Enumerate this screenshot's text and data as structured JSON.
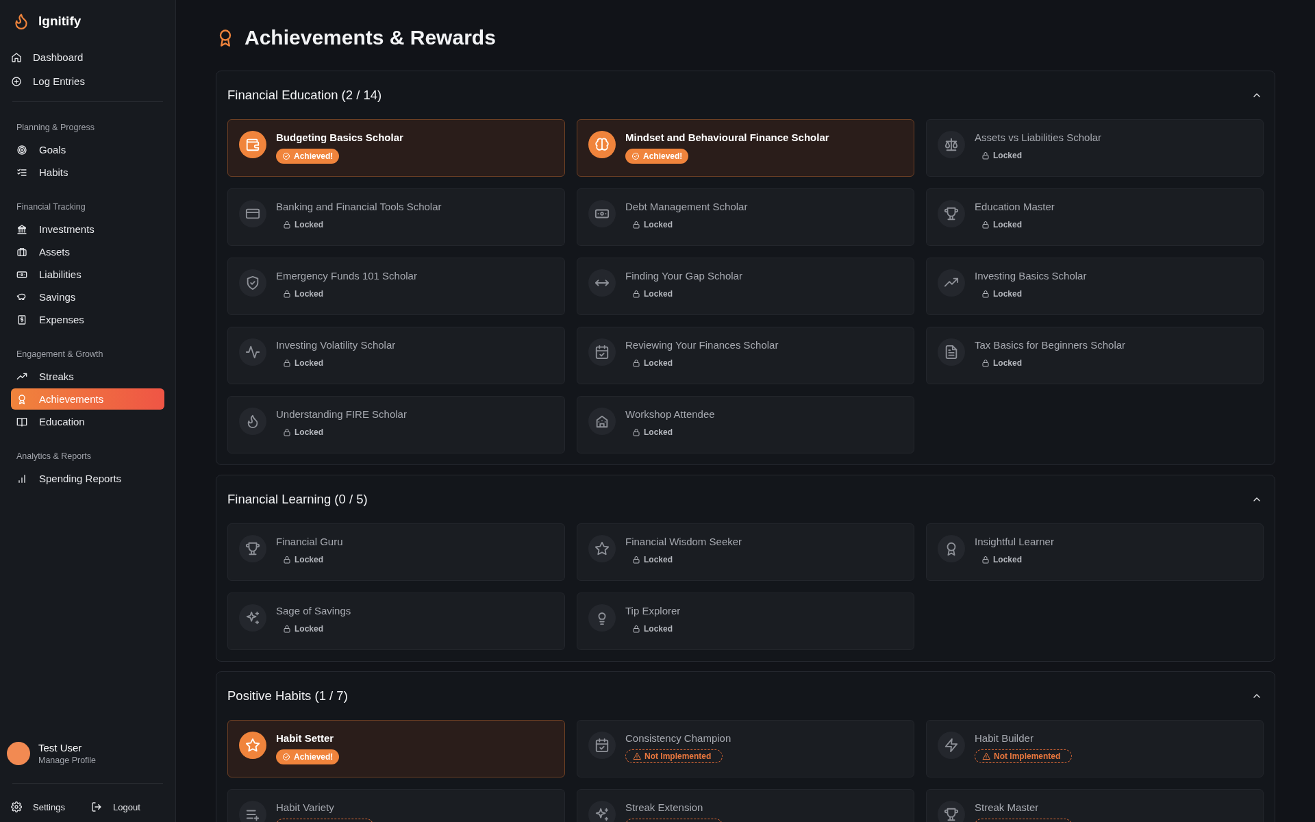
{
  "app": {
    "name": "Ignitify"
  },
  "sidebar": {
    "top_items": [
      {
        "label": "Dashboard",
        "selected": false
      },
      {
        "label": "Log Entries",
        "selected": false
      }
    ],
    "groups": [
      {
        "title": "Planning & Progress",
        "items": [
          {
            "label": "Goals",
            "selected": false
          },
          {
            "label": "Habits",
            "selected": false
          }
        ]
      },
      {
        "title": "Financial Tracking",
        "items": [
          {
            "label": "Investments",
            "selected": false
          },
          {
            "label": "Assets",
            "selected": false
          },
          {
            "label": "Liabilities",
            "selected": false
          },
          {
            "label": "Savings",
            "selected": false
          },
          {
            "label": "Expenses",
            "selected": false
          }
        ]
      },
      {
        "title": "Engagement & Growth",
        "items": [
          {
            "label": "Streaks",
            "selected": false
          },
          {
            "label": "Achievements",
            "selected": true
          },
          {
            "label": "Education",
            "selected": false
          }
        ]
      },
      {
        "title": "Analytics & Reports",
        "items": [
          {
            "label": "Spending Reports",
            "selected": false
          }
        ]
      }
    ],
    "user": {
      "name": "Test User",
      "subtitle": "Manage Profile"
    },
    "footer": [
      "Settings",
      "Logout"
    ]
  },
  "page": {
    "title": "Achievements & Rewards"
  },
  "sections": [
    {
      "title": "Financial Education (2 / 14)",
      "expanded": true,
      "items": [
        {
          "title": "Budgeting Basics Scholar",
          "kind": "achieved",
          "badge": "Achieved!"
        },
        {
          "title": "Mindset and Behavioural Finance Scholar",
          "kind": "achieved",
          "badge": "Achieved!"
        },
        {
          "title": "Assets vs Liabilities Scholar",
          "kind": "locked",
          "badge": "Locked"
        },
        {
          "title": "Banking and Financial Tools Scholar",
          "kind": "locked",
          "badge": "Locked"
        },
        {
          "title": "Debt Management Scholar",
          "kind": "locked",
          "badge": "Locked"
        },
        {
          "title": "Education Master",
          "kind": "locked",
          "badge": "Locked"
        },
        {
          "title": "Emergency Funds 101 Scholar",
          "kind": "locked",
          "badge": "Locked"
        },
        {
          "title": "Finding Your Gap Scholar",
          "kind": "locked",
          "badge": "Locked"
        },
        {
          "title": "Investing Basics Scholar",
          "kind": "locked",
          "badge": "Locked"
        },
        {
          "title": "Investing Volatility Scholar",
          "kind": "locked",
          "badge": "Locked"
        },
        {
          "title": "Reviewing Your Finances Scholar",
          "kind": "locked",
          "badge": "Locked"
        },
        {
          "title": "Tax Basics for Beginners Scholar",
          "kind": "locked",
          "badge": "Locked"
        },
        {
          "title": "Understanding FIRE Scholar",
          "kind": "locked",
          "badge": "Locked"
        },
        {
          "title": "Workshop Attendee",
          "kind": "locked",
          "badge": "Locked"
        }
      ]
    },
    {
      "title": "Financial Learning (0 / 5)",
      "expanded": true,
      "items": [
        {
          "title": "Financial Guru",
          "kind": "locked",
          "badge": "Locked"
        },
        {
          "title": "Financial Wisdom Seeker",
          "kind": "locked",
          "badge": "Locked"
        },
        {
          "title": "Insightful Learner",
          "kind": "locked",
          "badge": "Locked"
        },
        {
          "title": "Sage of Savings",
          "kind": "locked",
          "badge": "Locked"
        },
        {
          "title": "Tip Explorer",
          "kind": "locked",
          "badge": "Locked"
        }
      ]
    },
    {
      "title": "Positive Habits (1 / 7)",
      "expanded": true,
      "items": [
        {
          "title": "Habit Setter",
          "kind": "achieved",
          "badge": "Achieved!"
        },
        {
          "title": "Consistency Champion",
          "kind": "not_implemented",
          "badge": "Not Implemented"
        },
        {
          "title": "Habit Builder",
          "kind": "not_implemented",
          "badge": "Not Implemented"
        },
        {
          "title": "Habit Variety",
          "kind": "not_implemented"
        },
        {
          "title": "Streak Extension",
          "kind": "not_implemented"
        },
        {
          "title": "Streak Master",
          "kind": "not_implemented"
        }
      ]
    }
  ]
}
